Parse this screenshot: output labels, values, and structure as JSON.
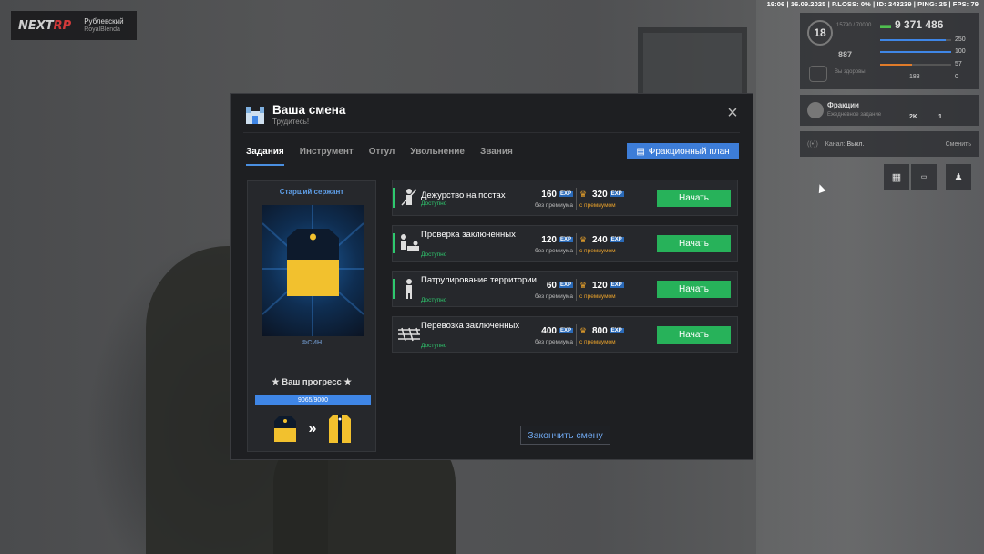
{
  "status_bar": "19:06 | 16.09.2025 | P.LOSS: 0% | ID: 243239 | PING: 25 | FPS: 79",
  "logo": {
    "brand_a": "NEXT",
    "brand_b": "RP",
    "server": "Рублевский",
    "server_sub": "RoyalBlenda"
  },
  "hud": {
    "level": "18",
    "xp": "15790 / 70000",
    "money": "9 371 486",
    "health": "250",
    "armor": "100",
    "hunger": "57",
    "stamina": "188",
    "wanted": "0",
    "rating": "887",
    "health_label": "Вы здоровы",
    "colors": {
      "money": "#4fbf4f",
      "bar_blue": "#3f86e6",
      "bar_orange": "#e07b2a"
    }
  },
  "faction_panel": {
    "title": "Фракции",
    "subtitle": "Ежедневное задание",
    "val1": "2K",
    "val2": "1"
  },
  "channel_panel": {
    "label": "Канал:",
    "value": "Выкл.",
    "action": "Сменить"
  },
  "modal": {
    "title": "Ваша смена",
    "subtitle": "Трудитесь!",
    "close": "×",
    "tabs": [
      "Задания",
      "Инструмент",
      "Отгул",
      "Увольнение",
      "Звания"
    ],
    "active_tab": 0,
    "plan_button": "Фракционный план",
    "rank": {
      "name": "Старший сержант",
      "org": "ФСИН",
      "progress_label": "★ Ваш прогресс ★",
      "progress_text": "9065/9000",
      "progress_fraction": 1.0
    },
    "tasks": [
      {
        "name": "Дежурство на постах",
        "status": "Доступно",
        "base": "160",
        "premium": "320",
        "base_caption": "без премиума",
        "premium_caption": "с премиумом",
        "exp": "EXP",
        "button": "Начать"
      },
      {
        "name": "Проверка заключенных",
        "status": "Доступно",
        "base": "120",
        "premium": "240",
        "base_caption": "без премиума",
        "premium_caption": "с премиумом",
        "exp": "EXP",
        "button": "Начать"
      },
      {
        "name": "Патрулирование территории",
        "status": "Доступно",
        "base": "60",
        "premium": "120",
        "base_caption": "без премиума",
        "premium_caption": "с премиумом",
        "exp": "EXP",
        "button": "Начать"
      },
      {
        "name": "Перевозка заключенных",
        "status": "Доступно",
        "base": "400",
        "premium": "800",
        "base_caption": "без премиума",
        "premium_caption": "с премиумом",
        "exp": "EXP",
        "button": "Начать"
      }
    ],
    "end_button": "Закончить смену",
    "colors": {
      "accent": "#3d7dd8",
      "green": "#27b25a",
      "premium": "#e8a12b"
    }
  }
}
